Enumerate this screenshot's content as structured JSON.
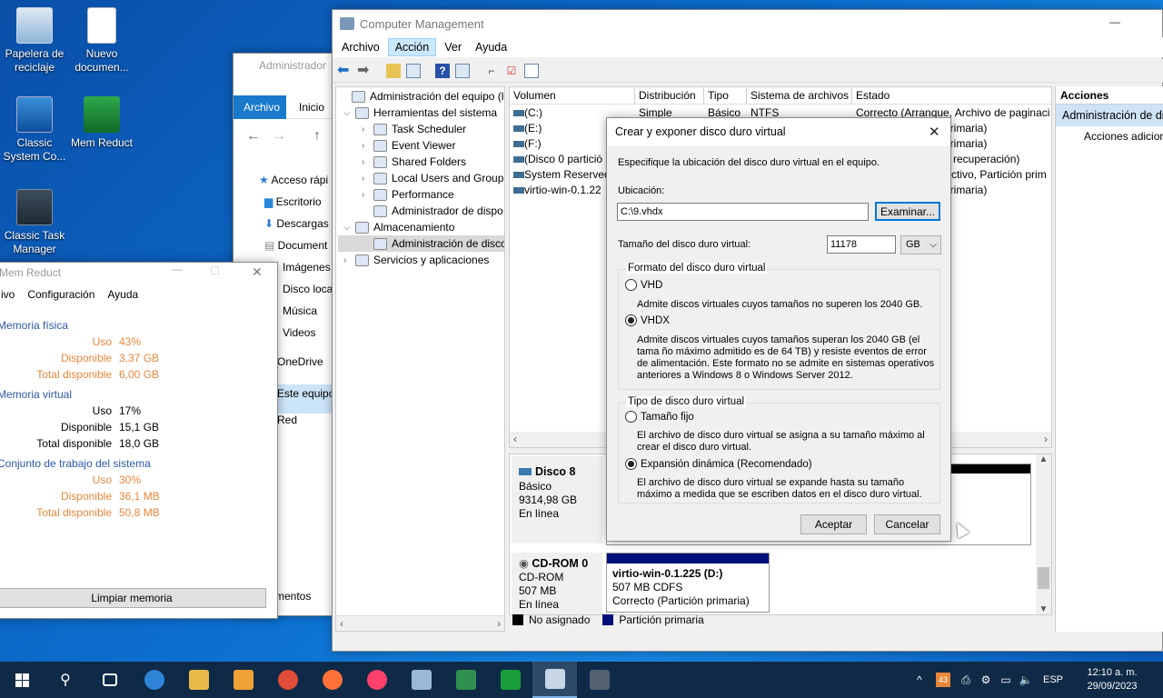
{
  "desktop": {
    "icons": [
      {
        "label": "Papelera de reciclaje",
        "icon": "recycle-bin-icon"
      },
      {
        "label": "Nuevo documen...",
        "icon": "document-icon"
      },
      {
        "label": "Classic System Co...",
        "icon": "system-config-icon"
      },
      {
        "label": "Mem Reduct",
        "icon": "memory-icon"
      },
      {
        "label": "Classic Task Manager",
        "icon": "task-manager-icon"
      }
    ]
  },
  "explorer": {
    "title": "Administrador",
    "tabs": [
      "Archivo",
      "Inicio"
    ],
    "nav": [
      "Acceso rápi",
      "Escritorio",
      "Descargas",
      "Document",
      "Imágenes",
      "Disco loca",
      "Música",
      "Videos",
      "OneDrive",
      "Este equipo",
      "Red"
    ],
    "status": "mentos"
  },
  "memreduct": {
    "title": "Mem Reduct",
    "menu": [
      "ivo",
      "Configuración",
      "Ayuda"
    ],
    "sections": [
      {
        "title": "Memoria física",
        "rows": [
          {
            "k": "Uso",
            "v": "43%"
          },
          {
            "k": "Disponible",
            "v": "3,37 GB"
          },
          {
            "k": "Total disponible",
            "v": "6,00 GB"
          }
        ],
        "orange": true
      },
      {
        "title": "Memoria virtual",
        "rows": [
          {
            "k": "Uso",
            "v": "17%"
          },
          {
            "k": "Disponible",
            "v": "15,1 GB"
          },
          {
            "k": "Total disponible",
            "v": "18,0 GB"
          }
        ],
        "orange": false
      },
      {
        "title": "Conjunto de trabajo del sistema",
        "rows": [
          {
            "k": "Uso",
            "v": "30%"
          },
          {
            "k": "Disponible",
            "v": "36,1 MB"
          },
          {
            "k": "Total disponible",
            "v": "50,8 MB"
          }
        ],
        "orange": true
      }
    ],
    "clean_button": "Limpiar memoria"
  },
  "compmgmt": {
    "title": "Computer Management",
    "menu": [
      "Archivo",
      "Acción",
      "Ver",
      "Ayuda"
    ],
    "tree": [
      {
        "label": "Administración del equipo (loc",
        "level": 0
      },
      {
        "label": "Herramientas del sistema",
        "level": 1
      },
      {
        "label": "Task Scheduler",
        "level": 2
      },
      {
        "label": "Event Viewer",
        "level": 2
      },
      {
        "label": "Shared Folders",
        "level": 2
      },
      {
        "label": "Local Users and Groups",
        "level": 2
      },
      {
        "label": "Performance",
        "level": 2
      },
      {
        "label": "Administrador de dispo",
        "level": 2
      },
      {
        "label": "Almacenamiento",
        "level": 1
      },
      {
        "label": "Administración de disco",
        "level": 2
      },
      {
        "label": "Servicios y aplicaciones",
        "level": 1
      }
    ],
    "columns": [
      "Volumen",
      "Distribución",
      "Tipo",
      "Sistema de archivos",
      "Estado"
    ],
    "volumes": [
      {
        "name": "(C:)",
        "dist": "Simple",
        "type": "Básico",
        "fs": "NTFS",
        "state": "Correcto (Arranque, Archivo de paginaci"
      },
      {
        "name": "(E:)",
        "state": "primaria)"
      },
      {
        "name": "(F:)",
        "state": "primaria)"
      },
      {
        "name": "(Disco 0 partició",
        "state": "e recuperación)"
      },
      {
        "name": "System Reserved",
        "state": "Activo, Partición prim"
      },
      {
        "name": "virtio-win-0.1.22",
        "state": "primaria)"
      }
    ],
    "disk8": {
      "name": "Disco 8",
      "type": "Básico",
      "size": "9314,98 GB",
      "status": "En línea"
    },
    "cdrom": {
      "name": "CD-ROM 0",
      "type": "CD-ROM",
      "size": "507 MB",
      "status": "En línea",
      "part_name": "virtio-win-0.1.225  (D:)",
      "part_fs": "507 MB CDFS",
      "part_state": "Correcto (Partición primaria)"
    },
    "legend": [
      "No asignado",
      "Partición primaria"
    ],
    "actions": {
      "header": "Acciones",
      "item": "Administración de dis",
      "sub": "Acciones adicior"
    }
  },
  "dialog": {
    "title": "Crear y exponer disco duro virtual",
    "intro": "Especifique la ubicación del disco duro virtual en el equipo.",
    "location_label": "Ubicación:",
    "location_value": "C:\\9.vhdx",
    "browse": "Examinar...",
    "size_label": "Tamaño del disco duro virtual:",
    "size_value": "11178",
    "unit": "GB",
    "format_group": "Formato del disco duro virtual",
    "vhd": "VHD",
    "vhd_desc": "Admite discos virtuales cuyos tamaños no superen los 2040 GB.",
    "vhdx": "VHDX",
    "vhdx_desc": "Admite discos virtuales cuyos tamaños superan los 2040 GB (el tama ño máximo admitido es de 64 TB) y resiste eventos de error de alimentación. Este formato no se admite en sistemas operativos anteriores a Windows 8 o Windows Server 2012.",
    "type_group": "Tipo de disco duro virtual",
    "fixed": "Tamaño fijo",
    "fixed_desc": "El archivo de disco duro virtual se asigna a su tamaño máximo al crear el disco duro virtual.",
    "dynamic": "Expansión dinámica (Recomendado)",
    "dynamic_desc": "El archivo de disco duro virtual se expande hasta su tamaño máximo a medida que se escriben datos en el disco duro virtual.",
    "ok": "Aceptar",
    "cancel": "Cancelar"
  },
  "taskbar": {
    "lang": "ESP",
    "time": "12:10 a. m.",
    "date": "29/09/2023",
    "notif_count": "43",
    "apps": [
      "task-view-icon",
      "edge-icon",
      "explorer-icon",
      "media-icon",
      "chrome-icon",
      "firefox-icon",
      "firefox-dev-icon",
      "sysconfig-icon",
      "taskmgr-icon",
      "memreduct-icon",
      "compmgmt-icon",
      "calculator-icon"
    ]
  },
  "colors": {
    "accent": "#0078d7",
    "taskbar": "#0e2a47",
    "unallocated": "#000000",
    "primary_partition": "#00107a"
  }
}
